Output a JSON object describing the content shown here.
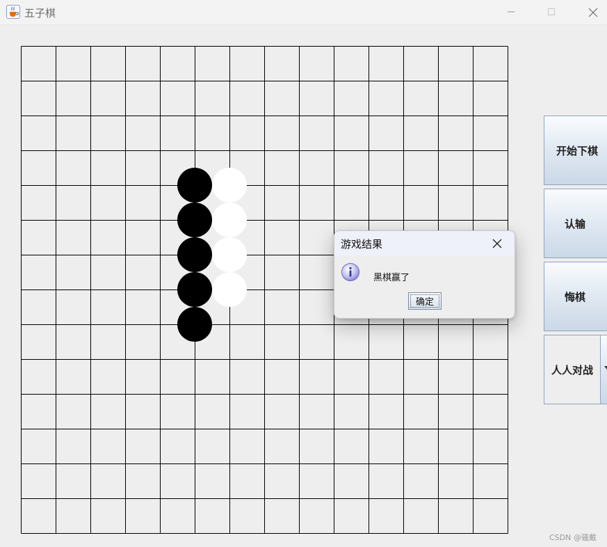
{
  "window": {
    "title": "五子棋",
    "icon": "java-cup-icon",
    "controls": [
      "minimize-icon",
      "maximize-icon",
      "close-icon"
    ]
  },
  "board": {
    "columns": 14,
    "rows": 14,
    "background": "#eeeeee",
    "line_color": "#000000",
    "stones": [
      {
        "color": "black",
        "col": 5,
        "row": 4
      },
      {
        "color": "black",
        "col": 5,
        "row": 5
      },
      {
        "color": "black",
        "col": 5,
        "row": 6
      },
      {
        "color": "black",
        "col": 5,
        "row": 7
      },
      {
        "color": "black",
        "col": 5,
        "row": 8
      },
      {
        "color": "white",
        "col": 6,
        "row": 4
      },
      {
        "color": "white",
        "col": 6,
        "row": 5
      },
      {
        "color": "white",
        "col": 6,
        "row": 6
      },
      {
        "color": "white",
        "col": 6,
        "row": 7
      }
    ]
  },
  "sidebar": {
    "start_label": "开始下棋",
    "resign_label": "认输",
    "undo_label": "悔棋",
    "mode_value": "人人对战"
  },
  "dialog": {
    "title": "游戏结果",
    "message": "黑棋赢了",
    "ok_label": "确定",
    "icon": "info-icon"
  },
  "watermark": "CSDN @骚戴"
}
